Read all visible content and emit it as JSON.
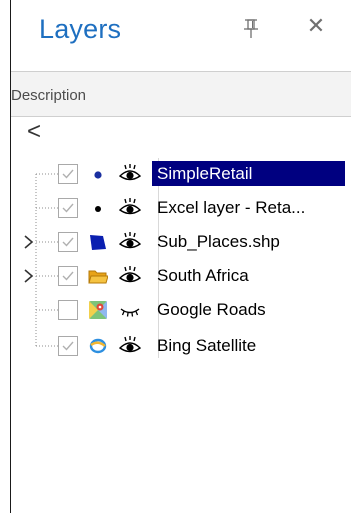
{
  "panel": {
    "title": "Layers",
    "pin_icon": "pin-icon",
    "close_glyph": "✕",
    "column_header": "Description",
    "back_glyph": "<"
  },
  "layers": [
    {
      "label": "SimpleRetail",
      "checked": true,
      "selected": true,
      "expandable": false,
      "icon": "point-layer-icon",
      "visibility": "eye-open-icon"
    },
    {
      "label": "Excel layer - Reta...",
      "checked": true,
      "selected": false,
      "expandable": false,
      "icon": "point-layer-icon",
      "visibility": "eye-open-icon"
    },
    {
      "label": "Sub_Places.shp",
      "checked": true,
      "selected": false,
      "expandable": true,
      "icon": "polygon-layer-icon",
      "visibility": "eye-open-icon"
    },
    {
      "label": "South Africa",
      "checked": true,
      "selected": false,
      "expandable": true,
      "icon": "folder-icon",
      "visibility": "eye-open-icon"
    },
    {
      "label": "Google Roads",
      "checked": false,
      "selected": false,
      "expandable": false,
      "icon": "google-maps-icon",
      "visibility": "eye-closed-icon"
    },
    {
      "label": "Bing Satellite",
      "checked": true,
      "selected": false,
      "expandable": false,
      "icon": "bing-icon",
      "visibility": "eye-open-icon"
    }
  ],
  "colors": {
    "title": "#1e6fc0",
    "selection": "#000080",
    "header_bg": "#f3f3f3"
  }
}
